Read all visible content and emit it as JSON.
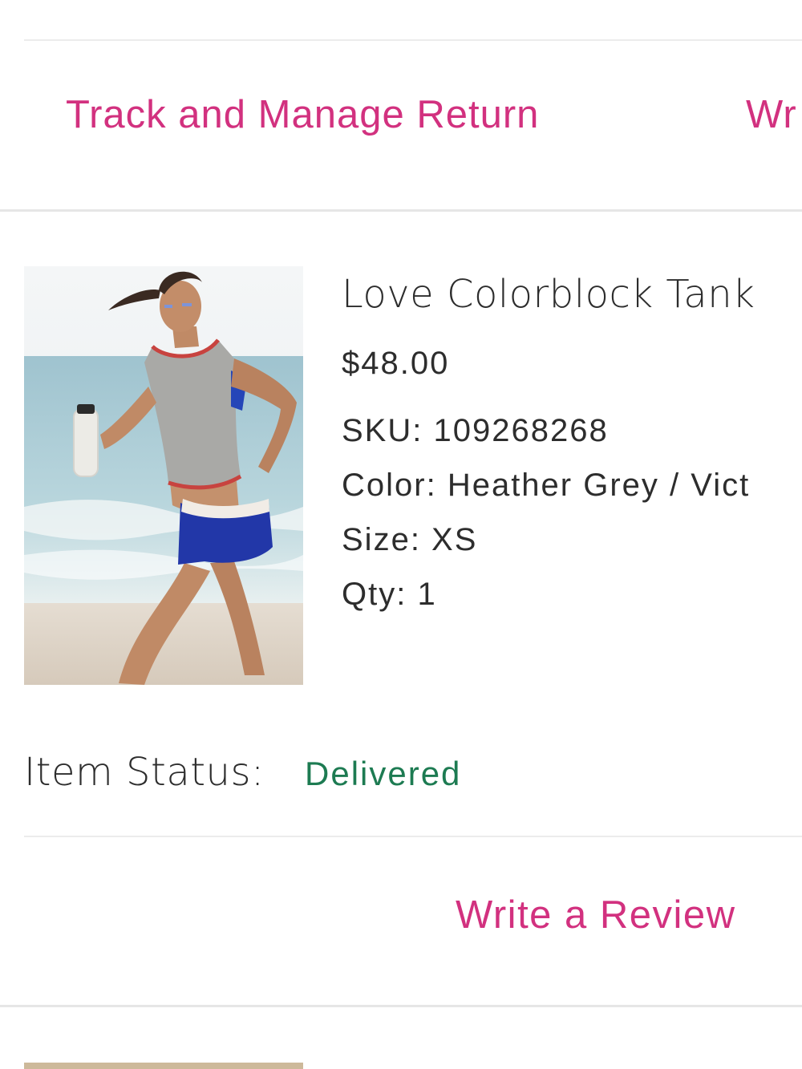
{
  "actions": {
    "track_return": "Track and Manage Return",
    "write_review_cut": "Wr"
  },
  "product": {
    "name": "Love Colorblock Tank",
    "price": "$48.00",
    "sku": "SKU: 109268268",
    "color": "Color: Heather Grey / Vict",
    "size": "Size: XS",
    "qty": "Qty: 1"
  },
  "status": {
    "label": "Item Status:",
    "value": "Delivered"
  },
  "review": {
    "label": "Write a Review"
  },
  "colors": {
    "link": "#d2317f",
    "status_green": "#1d7b52",
    "divider": "#ececec"
  }
}
